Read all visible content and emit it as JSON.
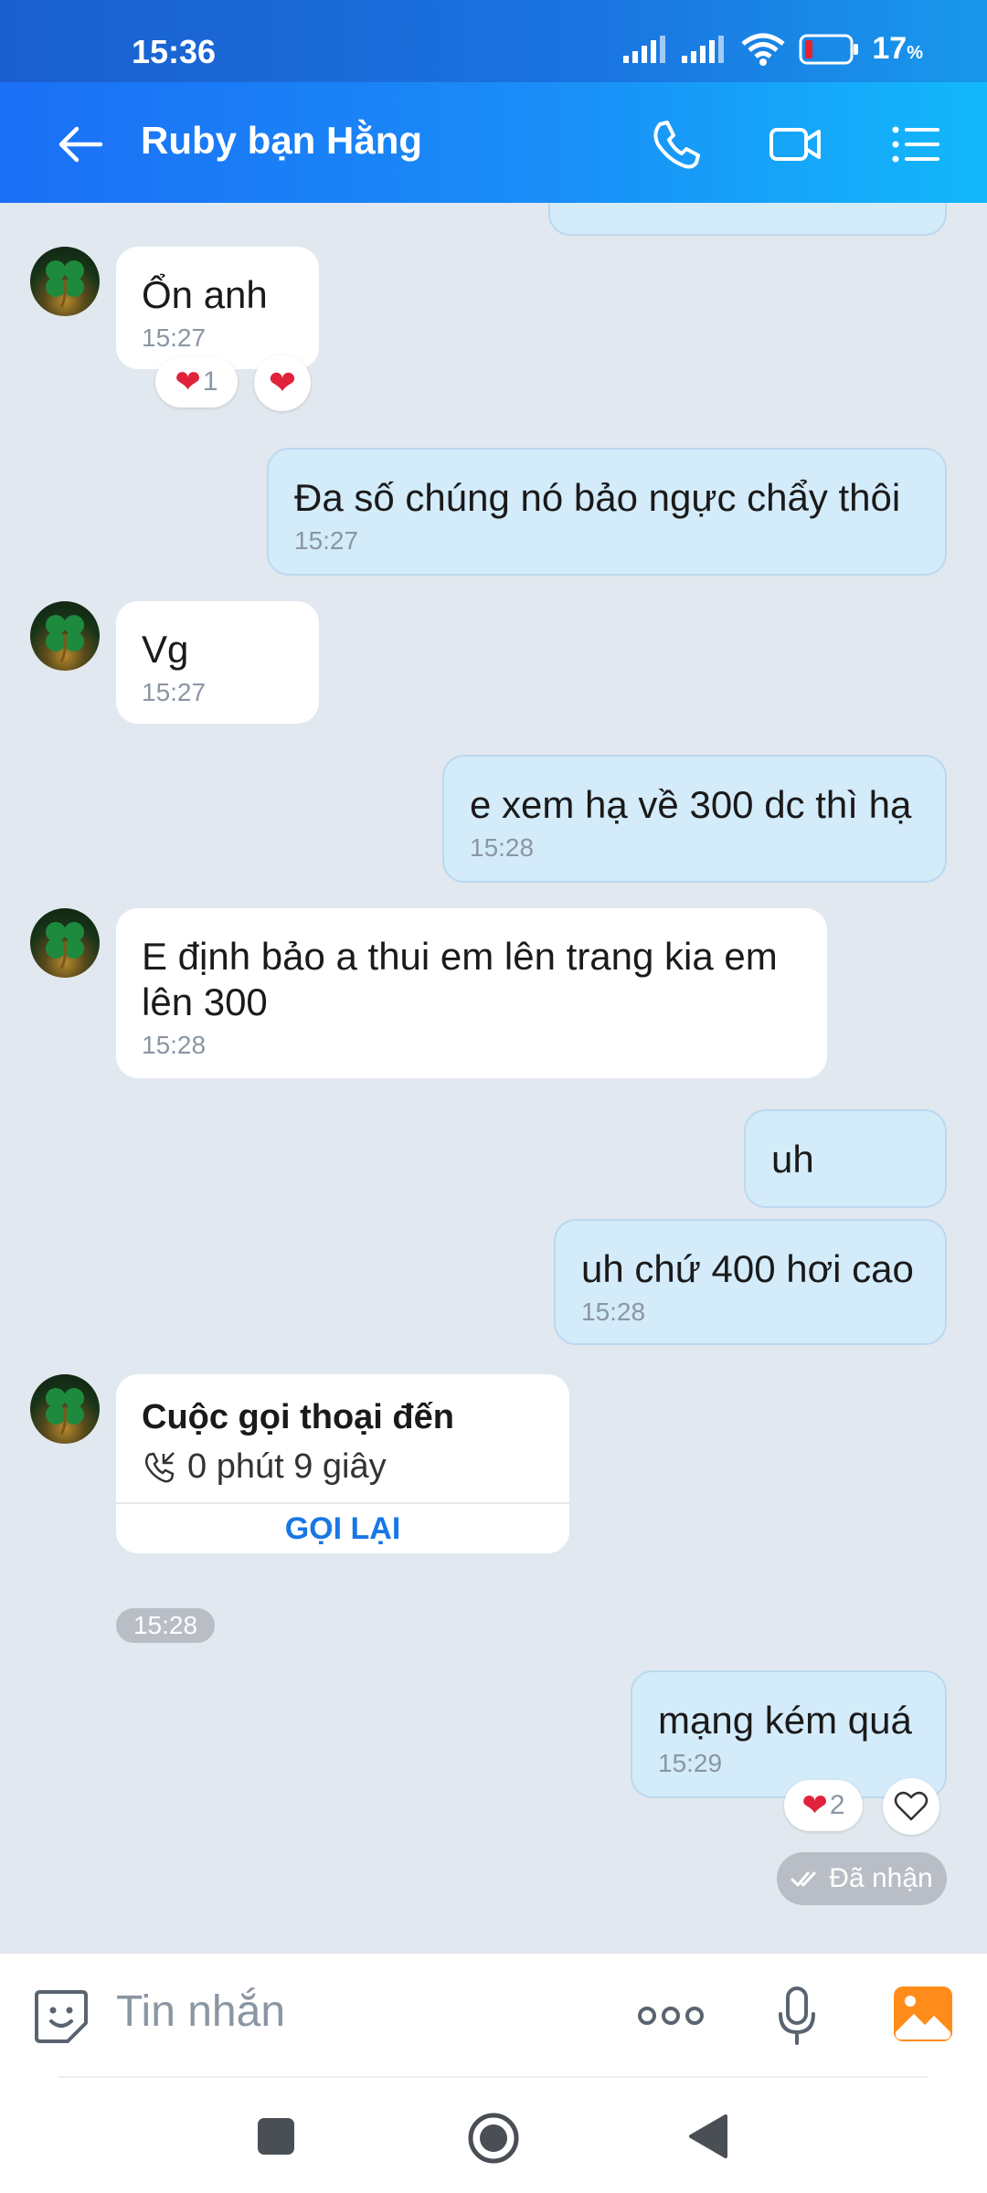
{
  "status_bar": {
    "time": "15:36",
    "battery": "17",
    "battery_unit": "%"
  },
  "header": {
    "title": "Ruby bạn Hằng"
  },
  "messages": [
    {
      "text": "Ổn anh",
      "time": "15:27"
    },
    {
      "text": "Đa số chúng nó bảo ngực chẩy thôi",
      "time": "15:27"
    },
    {
      "text": "Vg",
      "time": "15:27"
    },
    {
      "text": "e xem hạ về 300 dc thì hạ",
      "time": "15:28"
    },
    {
      "text": "E định bảo a thui em lên trang kia em lên 300",
      "time": "15:28"
    },
    {
      "text": "uh"
    },
    {
      "text": "uh chứ 400 hơi cao",
      "time": "15:28"
    },
    {
      "text": "mạng kém quá",
      "time": "15:29"
    }
  ],
  "reactions": {
    "first_count": "1",
    "last_count": "2"
  },
  "call_card": {
    "title": "Cuộc gọi thoại đến",
    "duration": "0 phút 9 giây",
    "callback_label": "GỌI LẠI",
    "time": "15:28"
  },
  "receipt": "Đã nhận",
  "composer": {
    "placeholder": "Tin nhắn"
  },
  "colors": {
    "accent": "#1877e6",
    "outgoing_bubble": "#d4ebfa",
    "heart": "#e0223b"
  }
}
